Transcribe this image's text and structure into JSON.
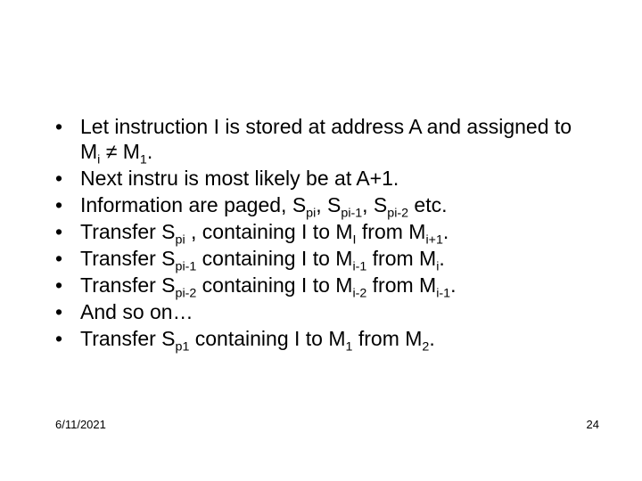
{
  "bullets": [
    {
      "html": "Let instruction I is stored at address A and assigned to M<sub>i</sub> ≠ M<sub>1</sub>."
    },
    {
      "html": "Next instru is most likely be at A+1."
    },
    {
      "html": "Information are paged, S<sub>pi</sub>, S<sub>pi-1</sub>, S<sub>pi-2</sub> etc."
    },
    {
      "html": "Transfer S<sub>pi</sub> , containing I to M<sub>I</sub> from M<sub>i+1</sub>."
    },
    {
      "html": "Transfer S<sub>pi-1</sub> containing I to M<sub>i-1</sub> from M<sub>i</sub>."
    },
    {
      "html": "Transfer S<sub>pi-2</sub> containing I to M<sub>i-2</sub> from M<sub>i-1</sub>."
    },
    {
      "html": "And so on…"
    },
    {
      "html": "Transfer S<sub>p1</sub> containing I to M<sub>1</sub> from M<sub>2</sub>."
    }
  ],
  "footer": {
    "date": "6/11/2021",
    "page": "24"
  }
}
